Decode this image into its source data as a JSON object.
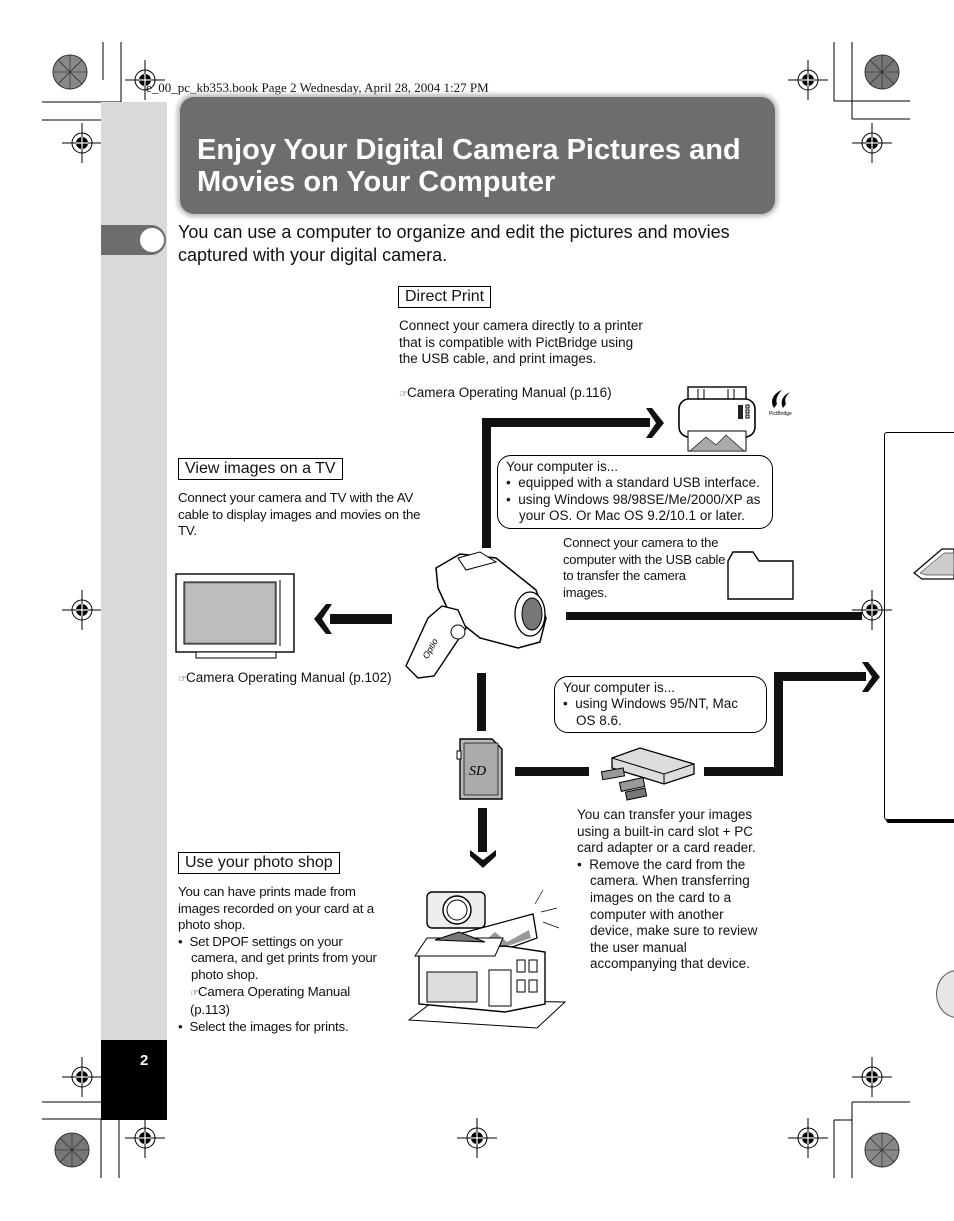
{
  "print_header": "e_00_pc_kb353.book  Page 2  Wednesday, April 28, 2004  1:27 PM",
  "page_number": "2",
  "title": {
    "line1": "Enjoy Your Digital Camera Pictures and",
    "line2": "Movies on Your Computer"
  },
  "intro": "You can use a computer to organize and edit the pictures and movies captured with your digital camera.",
  "direct_print": {
    "label": "Direct Print",
    "description": "Connect your camera directly to a printer that is compatible with PictBridge using the USB cable, and print images.",
    "ref_icon": "☞",
    "reference": "Camera Operating Manual (p.116)",
    "pictbridge_logo_text": "PictBridge"
  },
  "usb_bubble": {
    "heading": "Your computer is...",
    "bullets": [
      "equipped with a standard USB interface.",
      "using Windows 98/98SE/Me/2000/XP as your OS. Or Mac OS 9.2/10.1 or later."
    ]
  },
  "usb_connect": "Connect your camera to the computer with the USB cable to transfer the camera images.",
  "view_tv": {
    "label": "View images on a TV",
    "description": "Connect your camera and TV with the AV cable to display images and movies on the TV.",
    "ref_icon": "☞",
    "reference": "Camera Operating Manual (p.102)"
  },
  "legacy_bubble": {
    "heading": "Your computer is...",
    "bullets": [
      "using Windows 95/NT, Mac OS 8.6."
    ]
  },
  "sd_card_label": "SD",
  "card_reader": {
    "description": "You can transfer your images using a built-in card slot + PC card adapter or a card reader.",
    "bullets": [
      "Remove the card from the camera. When transferring images on the card to a computer with another device, make sure to review the user manual accompanying that device."
    ]
  },
  "photo_shop": {
    "label": "Use your photo shop",
    "description": "You can have prints made from images recorded on your card at a photo shop.",
    "bullet1": "Set DPOF settings on your camera, and get prints from your photo shop.",
    "ref_icon": "☞",
    "reference": "Camera Operating Manual (p.113)",
    "bullet2": "Select the images for prints."
  },
  "camera_brand": "Optio",
  "colors": {
    "title_bg": "#6e6c6d",
    "strip_gray": "#d9d9d9",
    "arrow": "#111111"
  }
}
